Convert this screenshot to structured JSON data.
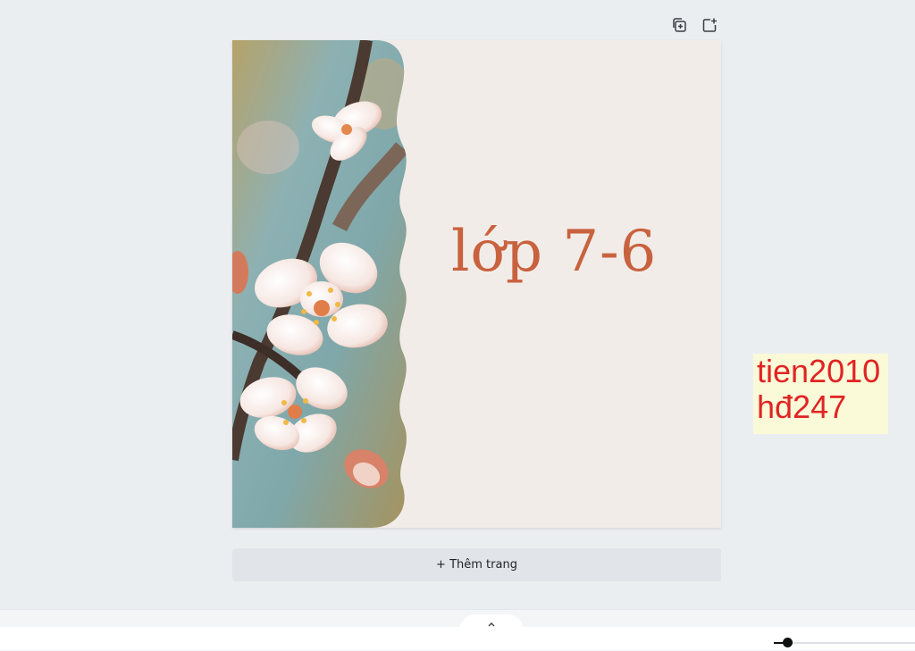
{
  "design": {
    "title": "lớp 7-6",
    "title_color": "#c8623e",
    "background_color": "#f2ece9",
    "image_subject": "blossom-photo"
  },
  "page_tools": {
    "duplicate_icon": "duplicate-page-icon",
    "add_icon": "add-page-icon"
  },
  "add_page_button": {
    "label": "+ Thêm trang"
  },
  "sticky_note": {
    "line1": "tien2010",
    "line2": "hđ247",
    "text_color": "#e02424",
    "background": "#fafad8"
  },
  "bottom_bar": {
    "expand_icon": "chevron-up-icon",
    "zoom_level_fraction": 0.08
  }
}
